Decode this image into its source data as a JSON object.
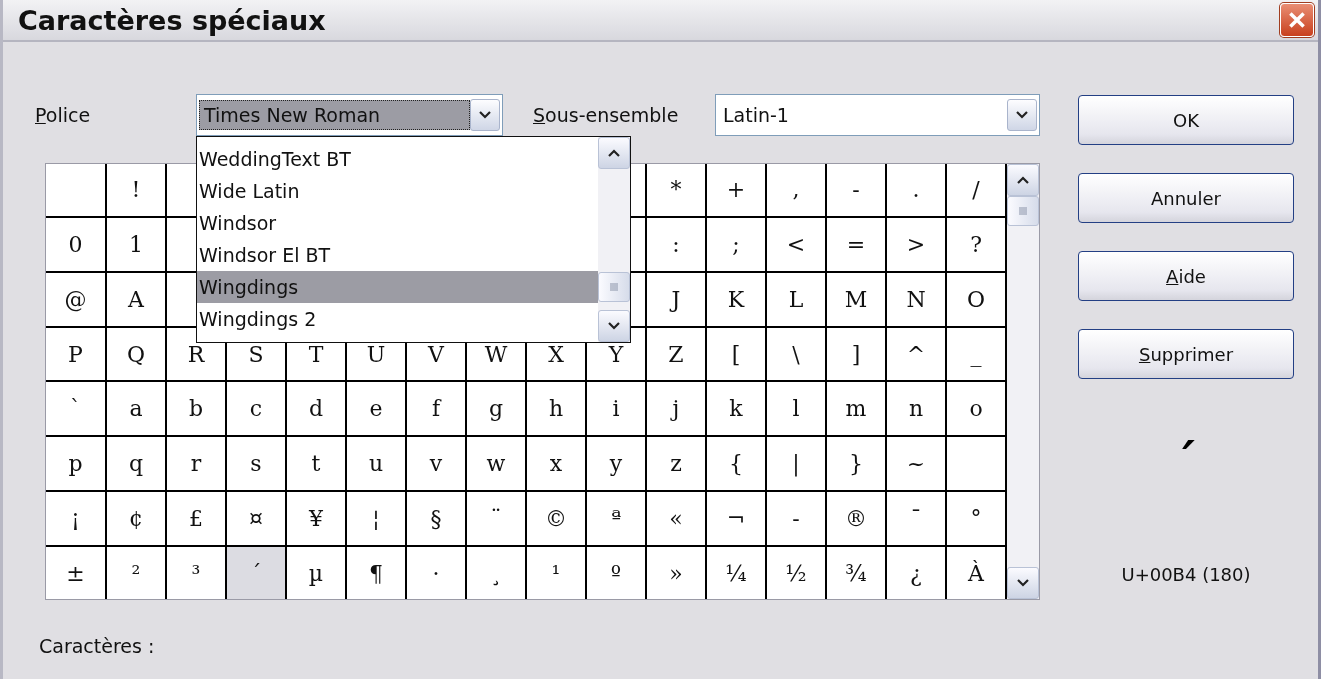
{
  "window": {
    "title": "Caractères spéciaux"
  },
  "font": {
    "label": "Police",
    "mnemonic": true,
    "value": "Times New Roman",
    "focused": true,
    "expanded": true,
    "options": [
      {
        "label": "WeddingText BT",
        "selected": false
      },
      {
        "label": "Wide Latin",
        "selected": false
      },
      {
        "label": "Windsor",
        "selected": false
      },
      {
        "label": "Windsor El BT",
        "selected": false
      },
      {
        "label": "Wingdings",
        "selected": true
      },
      {
        "label": "Wingdings 2",
        "selected": false
      }
    ]
  },
  "subset": {
    "label": "Sous-ensemble",
    "mnemonic": true,
    "value": "Latin-1"
  },
  "grid": {
    "rows": [
      [
        null,
        {
          "char": "!",
          "selected": false
        },
        null,
        null,
        null,
        null,
        null,
        null,
        null,
        null,
        {
          "char": "*",
          "selected": false
        },
        {
          "char": "+",
          "selected": false
        },
        {
          "char": ",",
          "selected": false
        },
        {
          "char": "-",
          "selected": false
        },
        {
          "char": ".",
          "selected": false
        },
        {
          "char": "/",
          "selected": false
        }
      ],
      [
        {
          "char": "0",
          "selected": false
        },
        {
          "char": "1",
          "selected": false
        },
        null,
        null,
        null,
        null,
        null,
        null,
        null,
        null,
        {
          "char": ":",
          "selected": false
        },
        {
          "char": ";",
          "selected": false
        },
        {
          "char": "<",
          "selected": false
        },
        {
          "char": "=",
          "selected": false
        },
        {
          "char": ">",
          "selected": false
        },
        {
          "char": "?",
          "selected": false
        }
      ],
      [
        {
          "char": "@",
          "selected": false
        },
        {
          "char": "A",
          "selected": false
        },
        null,
        null,
        null,
        null,
        null,
        null,
        null,
        null,
        {
          "char": "J",
          "selected": false
        },
        {
          "char": "K",
          "selected": false
        },
        {
          "char": "L",
          "selected": false
        },
        {
          "char": "M",
          "selected": false
        },
        {
          "char": "N",
          "selected": false
        },
        {
          "char": "O",
          "selected": false
        }
      ],
      [
        {
          "char": "P",
          "selected": false
        },
        {
          "char": "Q",
          "selected": false
        },
        {
          "char": "R",
          "selected": false
        },
        {
          "char": "S",
          "selected": false
        },
        {
          "char": "T",
          "selected": false
        },
        {
          "char": "U",
          "selected": false
        },
        {
          "char": "V",
          "selected": false
        },
        {
          "char": "W",
          "selected": false
        },
        {
          "char": "X",
          "selected": false
        },
        {
          "char": "Y",
          "selected": false
        },
        {
          "char": "Z",
          "selected": false
        },
        {
          "char": "[",
          "selected": false
        },
        {
          "char": "\\",
          "selected": false
        },
        {
          "char": "]",
          "selected": false
        },
        {
          "char": "^",
          "selected": false
        },
        {
          "char": "_",
          "selected": false
        }
      ],
      [
        {
          "char": "`",
          "selected": false
        },
        {
          "char": "a",
          "selected": false
        },
        {
          "char": "b",
          "selected": false
        },
        {
          "char": "c",
          "selected": false
        },
        {
          "char": "d",
          "selected": false
        },
        {
          "char": "e",
          "selected": false
        },
        {
          "char": "f",
          "selected": false
        },
        {
          "char": "g",
          "selected": false
        },
        {
          "char": "h",
          "selected": false
        },
        {
          "char": "i",
          "selected": false
        },
        {
          "char": "j",
          "selected": false
        },
        {
          "char": "k",
          "selected": false
        },
        {
          "char": "l",
          "selected": false
        },
        {
          "char": "m",
          "selected": false
        },
        {
          "char": "n",
          "selected": false
        },
        {
          "char": "o",
          "selected": false
        }
      ],
      [
        {
          "char": "p",
          "selected": false
        },
        {
          "char": "q",
          "selected": false
        },
        {
          "char": "r",
          "selected": false
        },
        {
          "char": "s",
          "selected": false
        },
        {
          "char": "t",
          "selected": false
        },
        {
          "char": "u",
          "selected": false
        },
        {
          "char": "v",
          "selected": false
        },
        {
          "char": "w",
          "selected": false
        },
        {
          "char": "x",
          "selected": false
        },
        {
          "char": "y",
          "selected": false
        },
        {
          "char": "z",
          "selected": false
        },
        {
          "char": "{",
          "selected": false
        },
        {
          "char": "|",
          "selected": false
        },
        {
          "char": "}",
          "selected": false
        },
        {
          "char": "~",
          "selected": false
        },
        null
      ],
      [
        {
          "char": "¡",
          "selected": false
        },
        {
          "char": "¢",
          "selected": false
        },
        {
          "char": "£",
          "selected": false
        },
        {
          "char": "¤",
          "selected": false
        },
        {
          "char": "¥",
          "selected": false
        },
        {
          "char": "¦",
          "selected": false
        },
        {
          "char": "§",
          "selected": false
        },
        {
          "char": "¨",
          "selected": false
        },
        {
          "char": "©",
          "selected": false
        },
        {
          "char": "ª",
          "selected": false
        },
        {
          "char": "«",
          "selected": false
        },
        {
          "char": "¬",
          "selected": false
        },
        {
          "char": "-",
          "selected": false
        },
        {
          "char": "®",
          "selected": false
        },
        {
          "char": "¯",
          "selected": false
        },
        {
          "char": "°",
          "selected": false
        }
      ],
      [
        {
          "char": "±",
          "selected": false
        },
        {
          "char": "²",
          "selected": false
        },
        {
          "char": "³",
          "selected": false
        },
        {
          "char": "´",
          "selected": true
        },
        {
          "char": "µ",
          "selected": false
        },
        {
          "char": "¶",
          "selected": false
        },
        {
          "char": "·",
          "selected": false
        },
        {
          "char": "¸",
          "selected": false
        },
        {
          "char": "¹",
          "selected": false
        },
        {
          "char": "º",
          "selected": false
        },
        {
          "char": "»",
          "selected": false
        },
        {
          "char": "¼",
          "selected": false
        },
        {
          "char": "½",
          "selected": false
        },
        {
          "char": "¾",
          "selected": false
        },
        {
          "char": "¿",
          "selected": false
        },
        {
          "char": "À",
          "selected": false
        }
      ]
    ]
  },
  "buttons": [
    {
      "label": "OK",
      "mnemonic": false
    },
    {
      "label": "Annuler",
      "mnemonic": false
    },
    {
      "label": "Aide",
      "mnemonic": true
    },
    {
      "label": "Supprimer",
      "mnemonic": true
    }
  ],
  "preview": {
    "glyph": "´",
    "code": "U+00B4 (180)"
  },
  "characters_label": "Caractères :"
}
